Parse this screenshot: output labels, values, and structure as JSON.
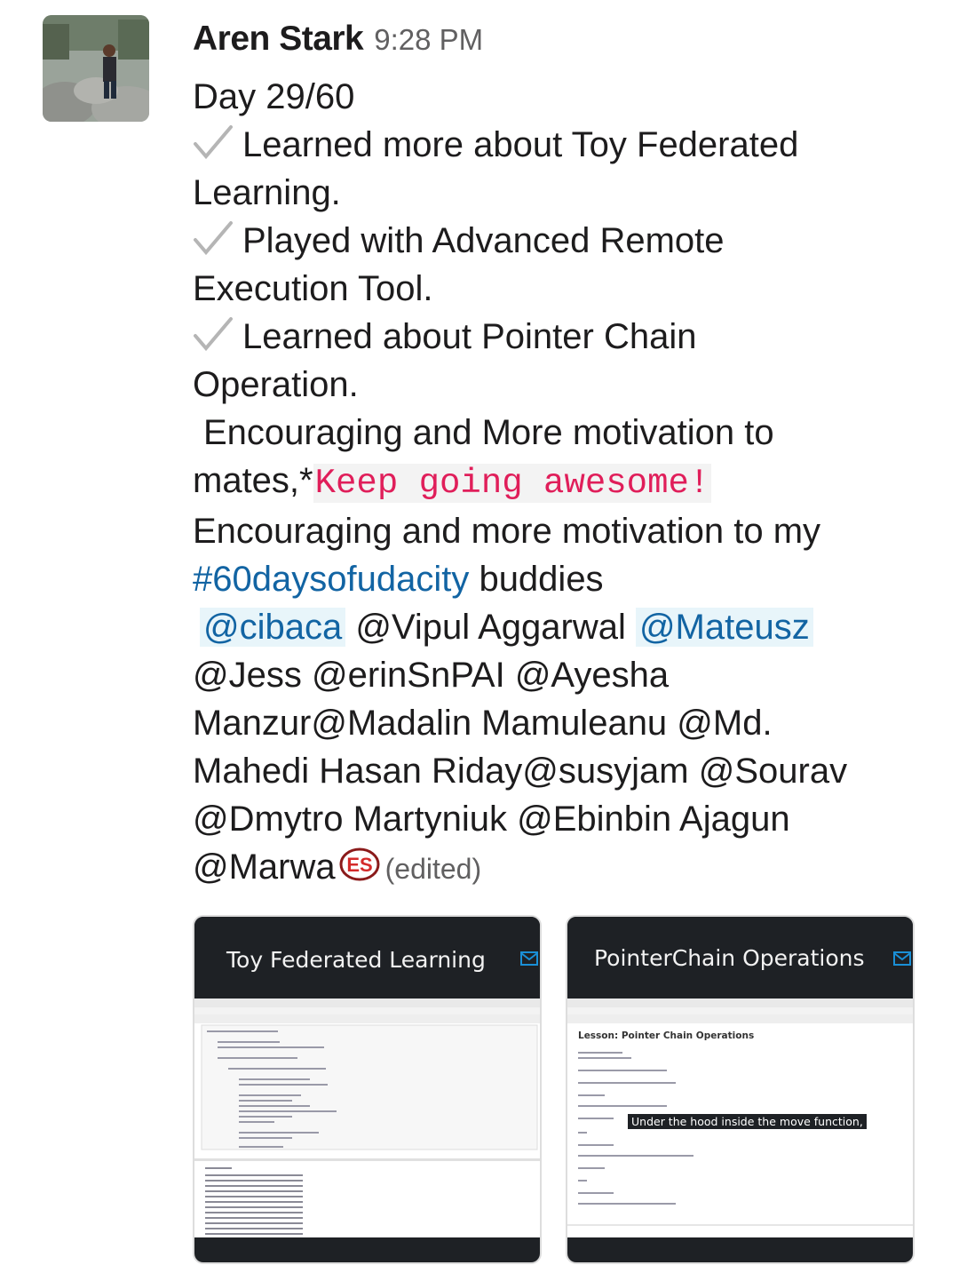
{
  "message": {
    "author": "Aren Stark",
    "time": "9:28 PM",
    "lines": {
      "day": "Day 29/60",
      "l1": "Learned more about Toy Federated",
      "l1b": "Learning.",
      "l2": "Played with Advanced Remote",
      "l2b": "Execution Tool.",
      "l3": "Learned about Pointer Chain",
      "l3b": "Operation.",
      "l4": "Encouraging and More motivation to",
      "l5a": "mates,*",
      "l5code": "Keep going awesome!",
      "l6": "Encouraging and more motivation to my",
      "hashtag": "#60daysofudacity",
      "l7b": " buddies",
      "m_cibaca": "@cibaca",
      "m_vipul": " @Vipul Aggarwal ",
      "m_mateusz": "@Mateusz",
      "l9": "@Jess @erinSnPAI @Ayesha",
      "l10": "Manzur@Madalin Mamuleanu @Md.",
      "l11": "Mahedi Hasan Riday@susyjam @Sourav",
      "l12": "@Dmytro Martyniuk @Ebinbin Ajagun",
      "l13": "@Marwa",
      "badge_text": "ES",
      "edited": "(edited)"
    },
    "colors": {
      "link": "#1264a3",
      "code": "#e01e5a",
      "mention_bg": "#e8f5fa"
    }
  },
  "attachments": [
    {
      "title": "Toy Federated Learning",
      "icon": "envelope-icon"
    },
    {
      "title": "PointerChain Operations",
      "icon": "envelope-icon",
      "lesson": "Lesson: Pointer Chain Operations",
      "caption": "Under the hood inside the move function,"
    }
  ]
}
